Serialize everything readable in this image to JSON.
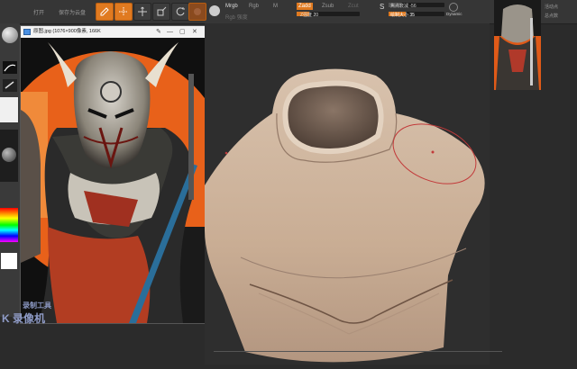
{
  "toolbar": {
    "open_label": "打开",
    "save_label": "保存为云盘",
    "tools": [
      {
        "name": "edit",
        "label": "Edit",
        "icon": "edit-icon",
        "active": true
      },
      {
        "name": "draw",
        "label": "Draw",
        "icon": "draw-icon",
        "active": true
      },
      {
        "name": "move",
        "label": "Move",
        "icon": "move-icon",
        "active": false
      },
      {
        "name": "scale",
        "label": "Scale",
        "icon": "scale-icon",
        "active": false
      },
      {
        "name": "rotate",
        "label": "Rotate",
        "icon": "rotate-icon",
        "active": false
      }
    ],
    "mrgb_label": "Mrgb",
    "rgb_label": "Rgb",
    "m_label": "M",
    "rgb_intensity_label": "Rgb 强度",
    "zadd_label": "Zadd",
    "zsub_label": "Zsub",
    "zcut_label": "Zcut",
    "z_intensity_label": "Z强度 20",
    "focal_shift_label": "焦点衰减 -56",
    "draw_size_label": "绘制大小 35",
    "dynamic_label": "Dynamic",
    "right_label_1": "活动点",
    "right_label_2": "总点数"
  },
  "reference_window": {
    "title": "原图.jpg (1076×900像素, 166K"
  },
  "watermark": {
    "line1": "录制工具",
    "line2": "K 录像机"
  },
  "colors": {
    "accent": "#e07a20",
    "background": "#2b2b2b",
    "clay": "#c9ad94"
  }
}
